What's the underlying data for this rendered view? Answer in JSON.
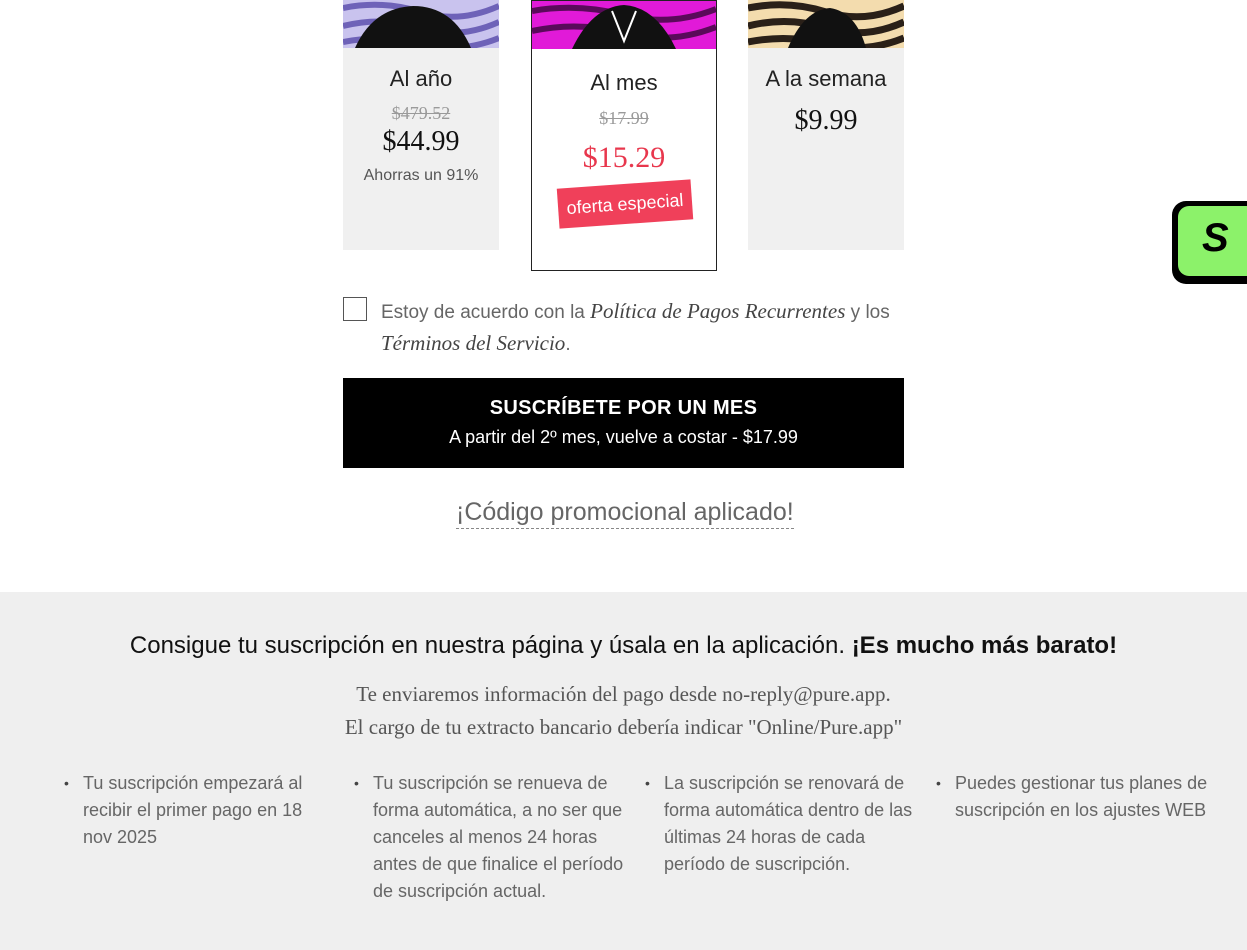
{
  "plans": {
    "year": {
      "title": "Al año",
      "old_price": "$479.52",
      "price": "$44.99",
      "saving": "Ahorras un 91%"
    },
    "month": {
      "title": "Al mes",
      "old_price": "$17.99",
      "price": "$15.29",
      "badge": "oferta especial",
      "selected": true
    },
    "week": {
      "title": "A la semana",
      "price": "$9.99"
    }
  },
  "consent": {
    "text_before": "Estoy de acuerdo con la ",
    "link_policy": "Política de Pagos Recurrentes",
    "text_middle": " y los ",
    "link_terms": "Términos del Servicio",
    "text_end": "."
  },
  "subscribe": {
    "title": "SUSCRÍBETE POR UN MES",
    "subtitle": "A partir del 2º mes, vuelve a costar - $17.99"
  },
  "promo_text": "¡Código promocional aplicado!",
  "info": {
    "title_regular": "Consigue tu suscripción en nuestra página y úsala en la aplicación. ",
    "title_bold": "¡Es mucho más barato!",
    "line1": "Te enviaremos información del pago desde no-reply@pure.app.",
    "line2": "El cargo de tu extracto bancario debería indicar \"Online/Pure.app\"",
    "bullets": [
      "Tu suscripción empezará al recibir el primer pago en 18 nov 2025",
      "Tu suscripción se renueva de forma automática, a no ser que canceles al menos 24 horas antes de que finalice el período de suscripción actual.",
      "La suscripción se renovará de forma automática dentro de las últimas 24 horas de cada período de suscripción.",
      "Puedes gestionar tus planes de suscripción en los ajustes WEB"
    ]
  },
  "side_widget": {
    "letter": "S"
  },
  "colors": {
    "accent_red": "#e8374d",
    "badge_red": "#f0405a",
    "widget_green": "#8cf26a"
  },
  "icons": {
    "bullet": "•"
  }
}
